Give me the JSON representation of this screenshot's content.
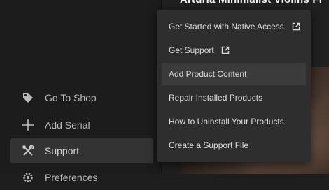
{
  "header": {
    "product_title": "Arturia Minimalist Violins Fr"
  },
  "sidebar": {
    "items": [
      {
        "label": "Go To Shop",
        "icon": "tag-icon"
      },
      {
        "label": "Add Serial",
        "icon": "plus-icon"
      },
      {
        "label": "Support",
        "icon": "tools-icon",
        "active": true
      },
      {
        "label": "Preferences",
        "icon": "gear-icon"
      }
    ]
  },
  "menu": {
    "items": [
      {
        "label": "Get Started with Native Access",
        "icon": "external-link-icon"
      },
      {
        "label": "Get Support",
        "icon": "external-link-icon"
      },
      {
        "label": "Add Product Content",
        "hovered": true
      },
      {
        "label": "Repair Installed Products"
      },
      {
        "label": "How to Uninstall Your Products"
      },
      {
        "label": "Create a Support File"
      }
    ]
  },
  "colors": {
    "background": "#1e1e1e",
    "menu": "#2e2e2e",
    "active_item": "#333333"
  }
}
